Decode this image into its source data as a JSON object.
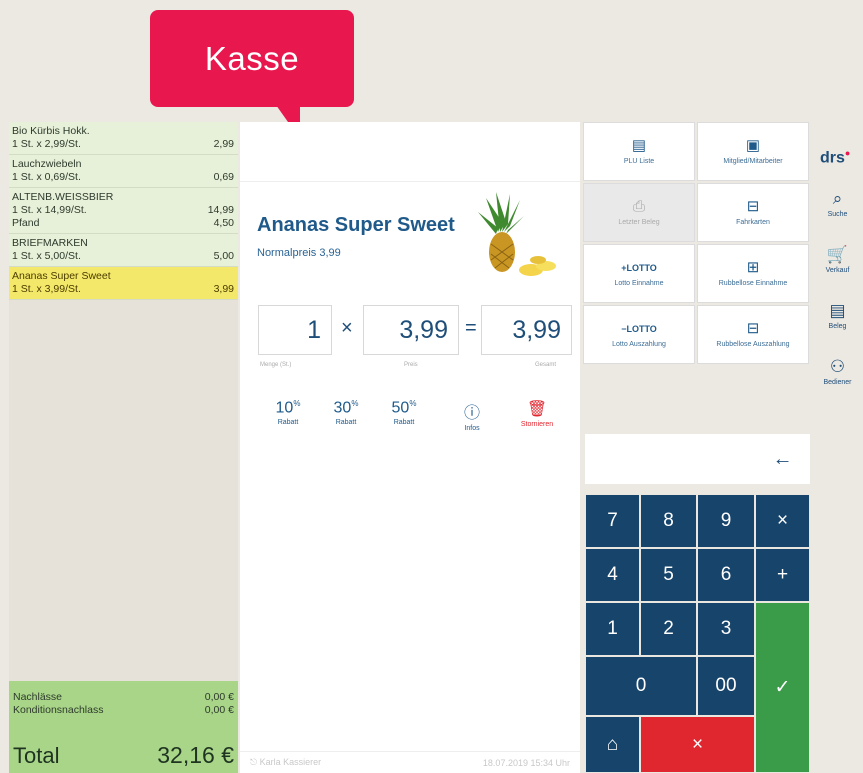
{
  "callout": {
    "label": "Kasse"
  },
  "receipt": {
    "items": [
      {
        "name": "Bio Kürbis Hokk.",
        "detail": "1 St. x 2,99/St.",
        "amount": "2,99",
        "extra_label": "",
        "extra_amount": "",
        "selected": false
      },
      {
        "name": "Lauchzwiebeln",
        "detail": "1 St. x 0,69/St.",
        "amount": "0,69",
        "extra_label": "",
        "extra_amount": "",
        "selected": false
      },
      {
        "name": "ALTENB.WEISSBIER",
        "detail": "1 St. x 14,99/St.",
        "amount": "14,99",
        "extra_label": "Pfand",
        "extra_amount": "4,50",
        "selected": false
      },
      {
        "name": "BRIEFMARKEN",
        "detail": "1 St. x 5,00/St.",
        "amount": "5,00",
        "extra_label": "",
        "extra_amount": "",
        "selected": false
      },
      {
        "name": "Ananas Super Sweet",
        "detail": "1 St. x 3,99/St.",
        "amount": "3,99",
        "extra_label": "",
        "extra_amount": "",
        "selected": true
      }
    ],
    "nachlaesse_label": "Nachlässe",
    "nachlaesse_value": "0,00 €",
    "konditionsnachlass_label": "Konditionsnachlass",
    "konditionsnachlass_value": "0,00 €",
    "total_label": "Total",
    "total_value": "32,16 €"
  },
  "product": {
    "name": "Ananas Super Sweet",
    "price_line": "Normalpreis 3,99",
    "quantity": "1",
    "quantity_caption": "Menge (St.)",
    "times": "×",
    "price": "3,99",
    "price_caption": "Preis",
    "equals": "=",
    "total": "3,99",
    "total_caption": "Gesamt"
  },
  "actions": [
    {
      "big": "10",
      "sup": "%",
      "label": "Rabatt"
    },
    {
      "big": "30",
      "sup": "%",
      "label": "Rabatt"
    },
    {
      "big": "50",
      "sup": "%",
      "label": "Rabatt"
    },
    {
      "big": "ⓘ",
      "sup": "",
      "label": "Infos"
    },
    {
      "big": "🗑",
      "sup": "",
      "label": "Stornieren"
    }
  ],
  "footer": {
    "user": "Karla Kassierer",
    "datetime": "18.07.2019   15:34 Uhr"
  },
  "functions": [
    {
      "icon": "list-icon",
      "glyph": "▤",
      "label": "PLU Liste"
    },
    {
      "icon": "id-card-icon",
      "glyph": "▣",
      "label": "Mitglied/Mitarbeiter"
    },
    {
      "icon": "printer-icon",
      "glyph": "⎙",
      "label": "Letzter Beleg"
    },
    {
      "icon": "ticket-icon",
      "glyph": "⊟",
      "label": "Fahrkarten"
    },
    {
      "icon": "lotto-plus-icon",
      "glyph": "+LOTTO",
      "label": "Lotto Einnahme"
    },
    {
      "icon": "scratchcard-plus-icon",
      "glyph": "⊞",
      "label": "Rubbellose Einnahme"
    },
    {
      "icon": "lotto-minus-icon",
      "glyph": "−LOTTO",
      "label": "Lotto Auszahlung"
    },
    {
      "icon": "scratchcard-minus-icon",
      "glyph": "⊟",
      "label": "Rubbellose Auszahlung"
    }
  ],
  "keypad": {
    "back": "←",
    "keys": [
      "7",
      "8",
      "9",
      "×",
      "4",
      "5",
      "6",
      "+",
      "1",
      "2",
      "3",
      "0",
      "00",
      "✓",
      "⌂",
      "×"
    ]
  },
  "nav": {
    "logo": "drs",
    "items": [
      {
        "icon": "search-icon",
        "glyph": "⌕",
        "label": "Suche"
      },
      {
        "icon": "cart-icon",
        "glyph": "🛒",
        "label": "Verkauf"
      },
      {
        "icon": "receipt-icon",
        "glyph": "▤",
        "label": "Beleg"
      },
      {
        "icon": "operators-icon",
        "glyph": "⚇",
        "label": "Bediener"
      }
    ]
  },
  "colors": {
    "callout": "#e8184f",
    "keypad": "#17446b",
    "confirm": "#3a9c48",
    "cancel": "#e0262f",
    "selected_item": "#f4e86a",
    "total_bg": "#a8d588"
  }
}
